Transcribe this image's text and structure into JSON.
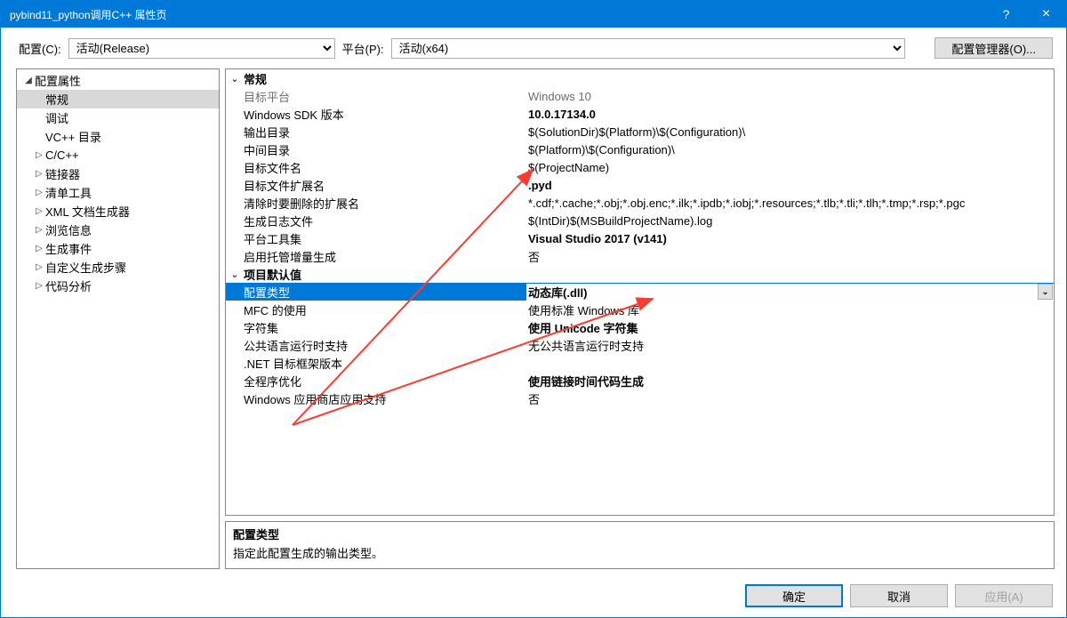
{
  "title": "pybind11_python调用C++ 属性页",
  "help": "?",
  "close": "×",
  "labels": {
    "config": "配置(C):",
    "platform": "平台(P):",
    "cfgmgr": "配置管理器(O)..."
  },
  "dropdowns": {
    "config": "活动(Release)",
    "platform": "活动(x64)"
  },
  "tree": {
    "root": "配置属性",
    "items": [
      {
        "label": "常规",
        "selected": true
      },
      {
        "label": "调试"
      },
      {
        "label": "VC++ 目录"
      },
      {
        "label": "C/C++",
        "expandable": true
      },
      {
        "label": "链接器",
        "expandable": true
      },
      {
        "label": "清单工具",
        "expandable": true
      },
      {
        "label": "XML 文档生成器",
        "expandable": true
      },
      {
        "label": "浏览信息",
        "expandable": true
      },
      {
        "label": "生成事件",
        "expandable": true
      },
      {
        "label": "自定义生成步骤",
        "expandable": true
      },
      {
        "label": "代码分析",
        "expandable": true
      }
    ]
  },
  "groups": [
    {
      "name": "常规",
      "rows": [
        {
          "label": "目标平台",
          "value": "Windows 10",
          "grey": true
        },
        {
          "label": "Windows SDK 版本",
          "value": "10.0.17134.0",
          "bold": true
        },
        {
          "label": "输出目录",
          "value": "$(SolutionDir)$(Platform)\\$(Configuration)\\"
        },
        {
          "label": "中间目录",
          "value": "$(Platform)\\$(Configuration)\\"
        },
        {
          "label": "目标文件名",
          "value": "$(ProjectName)"
        },
        {
          "label": "目标文件扩展名",
          "value": ".pyd",
          "bold": true
        },
        {
          "label": "清除时要删除的扩展名",
          "value": "*.cdf;*.cache;*.obj;*.obj.enc;*.ilk;*.ipdb;*.iobj;*.resources;*.tlb;*.tli;*.tlh;*.tmp;*.rsp;*.pgc"
        },
        {
          "label": "生成日志文件",
          "value": "$(IntDir)$(MSBuildProjectName).log"
        },
        {
          "label": "平台工具集",
          "value": "Visual Studio 2017 (v141)",
          "bold": true
        },
        {
          "label": "启用托管增量生成",
          "value": "否"
        }
      ]
    },
    {
      "name": "项目默认值",
      "rows": [
        {
          "label": "配置类型",
          "value": "动态库(.dll)",
          "bold": true,
          "selected": true
        },
        {
          "label": "MFC 的使用",
          "value": "使用标准 Windows 库"
        },
        {
          "label": "字符集",
          "value": "使用 Unicode 字符集",
          "bold": true
        },
        {
          "label": "公共语言运行时支持",
          "value": "无公共语言运行时支持"
        },
        {
          "label": ".NET 目标框架版本",
          "value": ""
        },
        {
          "label": "全程序优化",
          "value": "使用链接时间代码生成",
          "bold": true
        },
        {
          "label": "Windows 应用商店应用支持",
          "value": "否"
        }
      ]
    }
  ],
  "description": {
    "heading": "配置类型",
    "text": "指定此配置生成的输出类型。"
  },
  "buttons": {
    "ok": "确定",
    "cancel": "取消",
    "apply": "应用(A)"
  }
}
